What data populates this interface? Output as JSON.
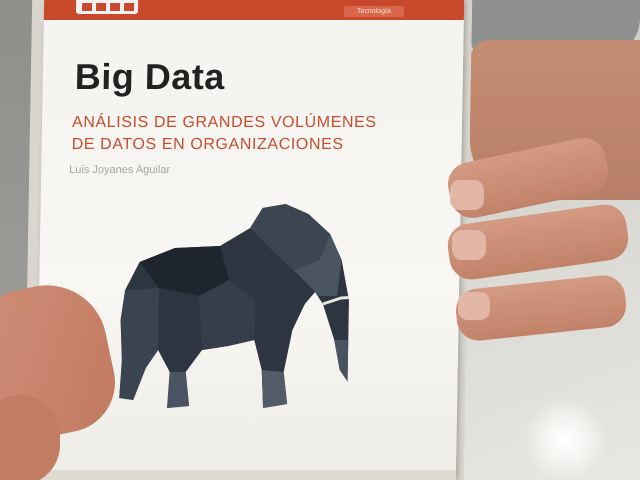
{
  "book": {
    "title": "Big Data",
    "subtitle_line1": "ANÁLISIS DE GRANDES VOLÚMENES",
    "subtitle_line2": "DE DATOS EN ORGANIZACIONES",
    "author": "Luis Joyanes Aguilar",
    "category_tag": "Tecnología",
    "accent_color": "#c9492c",
    "cover_color": "#f6f5f1"
  },
  "icons": {
    "illustration": "elephant-icon",
    "publisher_logo": "publisher-logo-icon"
  }
}
